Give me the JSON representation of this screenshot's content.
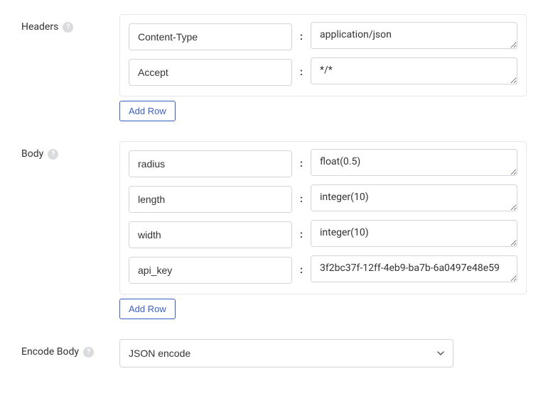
{
  "sections": {
    "headers": {
      "label": "Headers",
      "add_row_label": "Add Row",
      "rows": [
        {
          "key": "Content-Type",
          "value": "application/json"
        },
        {
          "key": "Accept",
          "value": "*/*"
        }
      ]
    },
    "body": {
      "label": "Body",
      "add_row_label": "Add Row",
      "rows": [
        {
          "key": "radius",
          "value": "float(0.5)"
        },
        {
          "key": "length",
          "value": "integer(10)"
        },
        {
          "key": "width",
          "value": "integer(10)"
        },
        {
          "key": "api_key",
          "value": "3f2bc37f-12ff-4eb9-ba7b-6a0497e48e59"
        }
      ]
    },
    "encode_body": {
      "label": "Encode Body",
      "selected": "JSON encode"
    }
  },
  "kv_separator": ":"
}
